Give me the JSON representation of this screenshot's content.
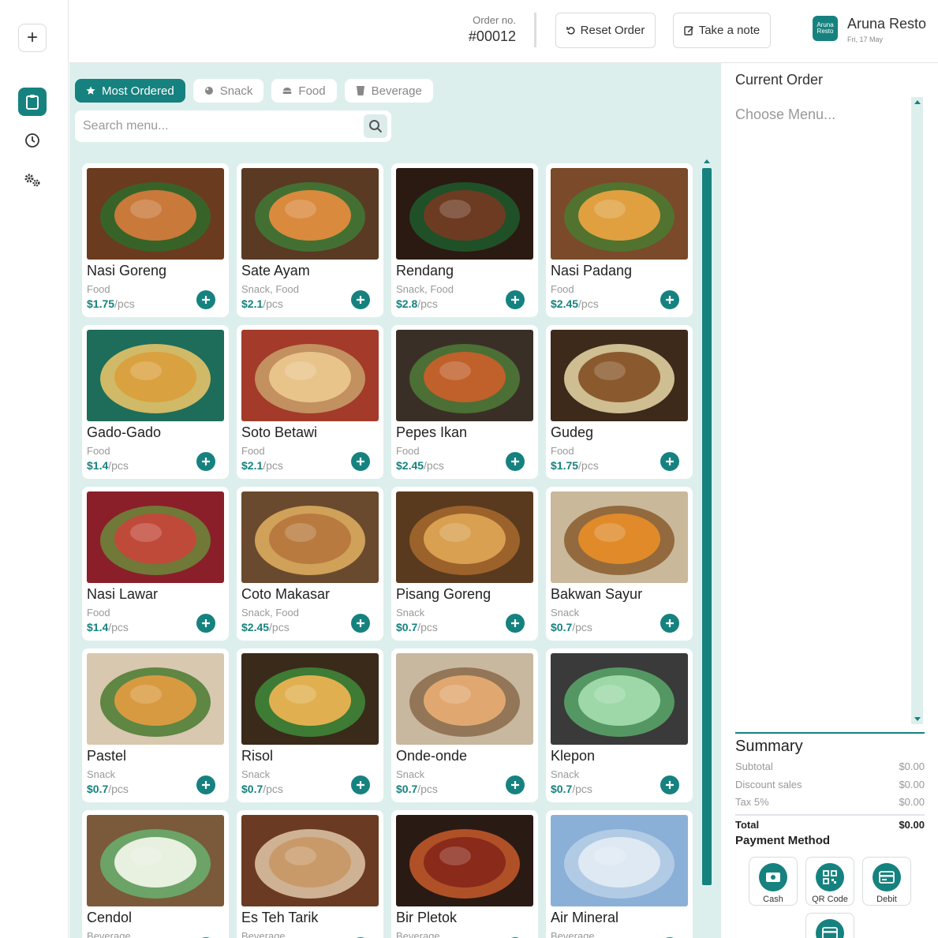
{
  "sidebar": {
    "add_label": "+",
    "items": [
      {
        "icon": "clipboard-icon",
        "active": true
      },
      {
        "icon": "clock-icon",
        "active": false
      },
      {
        "icon": "gears-icon",
        "active": false
      }
    ]
  },
  "header": {
    "order_label": "Order no.",
    "order_number": "#00012",
    "reset_label": "Reset Order",
    "note_label": "Take a note",
    "brand_logo": "Aruna Resto",
    "brand_name": "Aruna Resto",
    "date": "Fri, 17 May"
  },
  "categories": [
    {
      "label": "Most Ordered",
      "icon": "star-icon",
      "active": true
    },
    {
      "label": "Snack",
      "icon": "snack-icon",
      "active": false
    },
    {
      "label": "Food",
      "icon": "food-icon",
      "active": false
    },
    {
      "label": "Beverage",
      "icon": "cup-icon",
      "active": false
    }
  ],
  "search": {
    "placeholder": "Search menu..."
  },
  "menu_items": [
    {
      "name": "Nasi Goreng",
      "category": "Food",
      "price": "$1.75",
      "unit": "/pcs"
    },
    {
      "name": "Sate Ayam",
      "category": "Snack, Food",
      "price": "$2.1",
      "unit": "/pcs"
    },
    {
      "name": "Rendang",
      "category": "Snack, Food",
      "price": "$2.8",
      "unit": "/pcs"
    },
    {
      "name": "Nasi Padang",
      "category": "Food",
      "price": "$2.45",
      "unit": "/pcs"
    },
    {
      "name": "Gado-Gado",
      "category": "Food",
      "price": "$1.4",
      "unit": "/pcs"
    },
    {
      "name": "Soto Betawi",
      "category": "Food",
      "price": "$2.1",
      "unit": "/pcs"
    },
    {
      "name": "Pepes Ikan",
      "category": "Food",
      "price": "$2.45",
      "unit": "/pcs"
    },
    {
      "name": "Gudeg",
      "category": "Food",
      "price": "$1.75",
      "unit": "/pcs"
    },
    {
      "name": "Nasi Lawar",
      "category": "Food",
      "price": "$1.4",
      "unit": "/pcs"
    },
    {
      "name": "Coto Makasar",
      "category": "Snack, Food",
      "price": "$2.45",
      "unit": "/pcs"
    },
    {
      "name": "Pisang Goreng",
      "category": "Snack",
      "price": "$0.7",
      "unit": "/pcs"
    },
    {
      "name": "Bakwan Sayur",
      "category": "Snack",
      "price": "$0.7",
      "unit": "/pcs"
    },
    {
      "name": "Pastel",
      "category": "Snack",
      "price": "$0.7",
      "unit": "/pcs"
    },
    {
      "name": "Risol",
      "category": "Snack",
      "price": "$0.7",
      "unit": "/pcs"
    },
    {
      "name": "Onde-onde",
      "category": "Snack",
      "price": "$0.7",
      "unit": "/pcs"
    },
    {
      "name": "Klepon",
      "category": "Snack",
      "price": "$0.7",
      "unit": "/pcs"
    },
    {
      "name": "Cendol",
      "category": "Beverage",
      "price": "",
      "unit": ""
    },
    {
      "name": "Es Teh Tarik",
      "category": "Beverage",
      "price": "",
      "unit": ""
    },
    {
      "name": "Bir Pletok",
      "category": "Beverage",
      "price": "",
      "unit": ""
    },
    {
      "name": "Air Mineral",
      "category": "Beverage",
      "price": "",
      "unit": ""
    }
  ],
  "order": {
    "title": "Current Order",
    "empty_text": "Choose Menu..."
  },
  "summary": {
    "title": "Summary",
    "subtotal_label": "Subtotal",
    "subtotal": "$0.00",
    "discount_label": "Discount sales",
    "discount": "$0.00",
    "tax_label": "Tax 5%",
    "tax": "$0.00",
    "total_label": "Total",
    "total": "$0.00"
  },
  "payment": {
    "title": "Payment Method",
    "methods": [
      {
        "label": "Cash",
        "icon": "cash-icon"
      },
      {
        "label": "QR Code",
        "icon": "qr-code-icon"
      },
      {
        "label": "Debit",
        "icon": "card-icon"
      },
      {
        "label": "",
        "icon": "credit-card-icon"
      }
    ]
  },
  "colors": {
    "accent": "#16827f",
    "background": "#ddefed"
  }
}
